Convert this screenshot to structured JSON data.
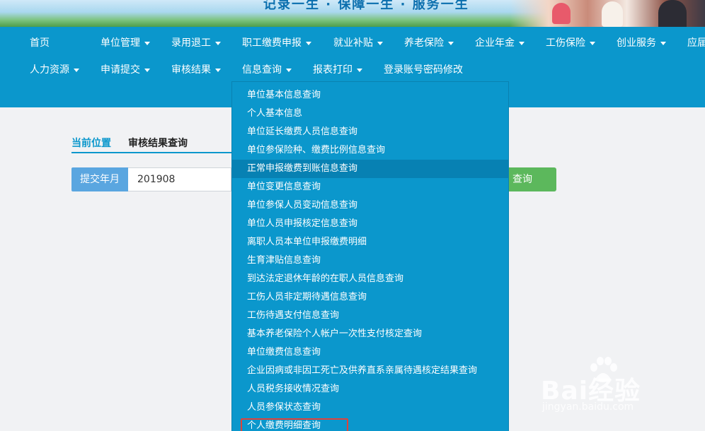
{
  "banner": {
    "slogan": "记录一生 · 保障一生 · 服务一生"
  },
  "nav": {
    "row1": [
      {
        "label": "首页",
        "caret": false
      },
      {
        "label": "单位管理",
        "caret": true
      },
      {
        "label": "录用退工",
        "caret": true
      },
      {
        "label": "职工缴费申报",
        "caret": true
      },
      {
        "label": "就业补贴",
        "caret": true
      },
      {
        "label": "养老保险",
        "caret": true
      },
      {
        "label": "企业年金",
        "caret": true
      },
      {
        "label": "工伤保险",
        "caret": true
      },
      {
        "label": "创业服务",
        "caret": true
      },
      {
        "label": "应届",
        "caret": false
      }
    ],
    "row2": [
      {
        "label": "人力资源",
        "caret": true
      },
      {
        "label": "申请提交",
        "caret": true
      },
      {
        "label": "审核结果",
        "caret": true
      },
      {
        "label": "信息查询",
        "caret": true
      },
      {
        "label": "报表打印",
        "caret": true
      },
      {
        "label": "登录账号密码修改",
        "caret": false
      }
    ]
  },
  "breadcrumb": {
    "position_label": "当前位置",
    "page_title": "审核结果查询"
  },
  "search": {
    "field_label": "提交年月",
    "field_value": "201908",
    "button_label": "查询"
  },
  "dropdown": {
    "items": [
      "单位基本信息查询",
      "个人基本信息",
      "单位延长缴费人员信息查询",
      "单位参保险种、缴费比例信息查询",
      "正常申报缴费到账信息查询",
      "单位变更信息查询",
      "单位参保人员变动信息查询",
      "单位人员申报核定信息查询",
      "离职人员本单位申报缴费明细",
      "生育津贴信息查询",
      "到达法定退休年龄的在职人员信息查询",
      "工伤人员非定期待遇信息查询",
      "工伤待遇支付信息查询",
      "基本养老保险个人帐户一次性支付核定查询",
      "单位缴费信息查询",
      "企业因病或非因工死亡及供养直系亲属待遇核定结果查询",
      "人员税务接收情况查询",
      "人员参保状态查询",
      "个人缴费明细查询"
    ],
    "active_index": 4,
    "highlighted_index": 18
  },
  "watermark": {
    "logo": "Bai经验",
    "url": "jingyan.baidu.com"
  },
  "colors": {
    "nav_bg": "#0b97cc",
    "button_green": "#5cb85c",
    "label_blue": "#5aa6e0",
    "highlight_red": "#e0423a"
  }
}
